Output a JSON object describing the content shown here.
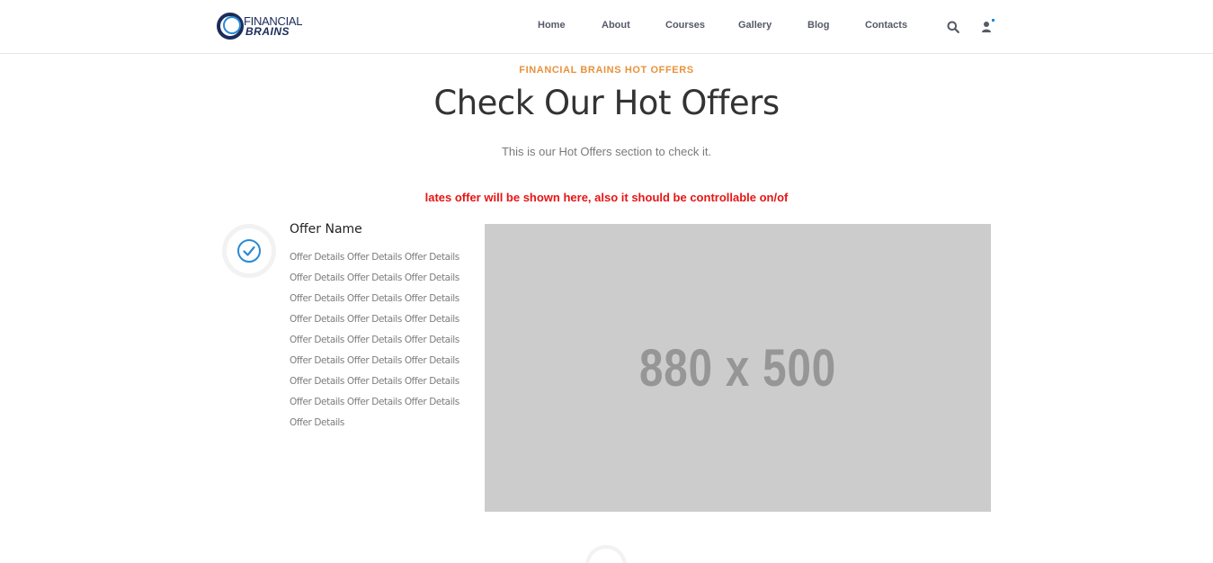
{
  "header": {
    "logo": {
      "top": "FINANCIAL",
      "bottom": "BRAINS"
    },
    "nav": [
      {
        "label": "Home"
      },
      {
        "label": "About"
      },
      {
        "label": "Courses"
      },
      {
        "label": "Gallery"
      },
      {
        "label": "Blog"
      },
      {
        "label": "Contacts"
      }
    ],
    "icons": {
      "search": "search-icon",
      "user": "user-icon"
    },
    "colors": {
      "nav_text": "#555a66",
      "logo": "#1c2b5a",
      "logo_accent": "#2a8ad4"
    }
  },
  "section": {
    "eyebrow": "FINANCIAL BRAINS HOT OFFERS",
    "title": "Check Our Hot Offers",
    "subtitle": "This is our Hot Offers section to check it.",
    "notice": "lates offer will be shown here, also it should be controllable on/of",
    "colors": {
      "eyebrow": "#e8923a",
      "notice": "#e81414",
      "check": "#2a8ad4"
    }
  },
  "offer": {
    "name": "Offer Name",
    "detail_lines": [
      "Offer Details Offer Details Offer Details",
      "Offer Details Offer Details Offer Details",
      "Offer Details Offer Details Offer Details",
      "Offer Details Offer Details Offer Details",
      "Offer Details Offer Details Offer Details",
      "Offer Details Offer Details Offer Details",
      "Offer Details Offer Details Offer Details",
      "Offer Details Offer Details Offer Details",
      "Offer Details"
    ],
    "image_placeholder": "880 x 500",
    "icon": "check-circle-icon"
  }
}
